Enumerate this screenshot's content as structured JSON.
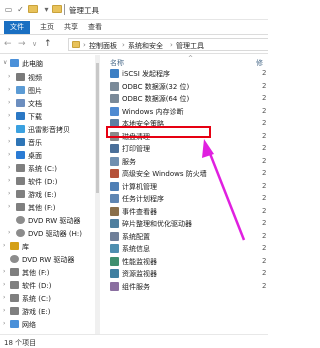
{
  "window": {
    "title": "管理工具"
  },
  "ribbon": {
    "tabs": [
      "文件",
      "主页",
      "共享",
      "查看"
    ]
  },
  "address": {
    "back": "←",
    "forward": "→",
    "recent": "∨",
    "up": "↑",
    "crumbs": [
      "控制面板",
      "系统和安全",
      "管理工具"
    ],
    "separator": "›"
  },
  "columns": {
    "name": "名称",
    "date_prefix": "修"
  },
  "nav": {
    "items": [
      {
        "label": "此电脑",
        "color": "#4a90d9"
      },
      {
        "label": "视频",
        "color": "#7a7a7a"
      },
      {
        "label": "图片",
        "color": "#5b9bd5"
      },
      {
        "label": "文档",
        "color": "#6c8ebf"
      },
      {
        "label": "下载",
        "color": "#2b78c5"
      },
      {
        "label": "迅雷影音拷贝",
        "color": "#3ba1e0"
      },
      {
        "label": "音乐",
        "color": "#2e75b6"
      },
      {
        "label": "桌面",
        "color": "#2a7bd4"
      },
      {
        "label": "系统 (C:)",
        "color": "#7f7f7f"
      },
      {
        "label": "软件 (D:)",
        "color": "#7f7f7f"
      },
      {
        "label": "游戏 (E:)",
        "color": "#7f7f7f"
      },
      {
        "label": "其他 (F:)",
        "color": "#7f7f7f"
      },
      {
        "label": "DVD RW 驱动器",
        "color": "#8c8c8c"
      },
      {
        "label": "DVD 驱动器 (H:)",
        "color": "#8c8c8c"
      },
      {
        "label": "库",
        "color": "#d4a017"
      },
      {
        "label": "DVD RW 驱动器",
        "color": "#8c8c8c"
      },
      {
        "label": "其他 (F:)",
        "color": "#7f7f7f"
      },
      {
        "label": "软件 (D:)",
        "color": "#7f7f7f"
      },
      {
        "label": "系统 (C:)",
        "color": "#7f7f7f"
      },
      {
        "label": "游戏 (E:)",
        "color": "#7f7f7f"
      },
      {
        "label": "网络",
        "color": "#4a90d9"
      }
    ]
  },
  "files": [
    {
      "name": "iSCSI 发起程序",
      "date": "2"
    },
    {
      "name": "ODBC 数据源(32 位)",
      "date": "2"
    },
    {
      "name": "ODBC 数据源(64 位)",
      "date": "2"
    },
    {
      "name": "Windows 内存诊断",
      "date": "2"
    },
    {
      "name": "本地安全策略",
      "date": "2"
    },
    {
      "name": "磁盘清理",
      "date": "2"
    },
    {
      "name": "打印管理",
      "date": "2"
    },
    {
      "name": "服务",
      "date": "2"
    },
    {
      "name": "高级安全 Windows 防火墙",
      "date": "2"
    },
    {
      "name": "计算机管理",
      "date": "2"
    },
    {
      "name": "任务计划程序",
      "date": "2"
    },
    {
      "name": "事件查看器",
      "date": "2"
    },
    {
      "name": "碎片整理和优化驱动器",
      "date": "2"
    },
    {
      "name": "系统配置",
      "date": "2"
    },
    {
      "name": "系统信息",
      "date": "2"
    },
    {
      "name": "性能监视器",
      "date": "2"
    },
    {
      "name": "资源监视器",
      "date": "2"
    },
    {
      "name": "组件服务",
      "date": "2"
    }
  ],
  "status": {
    "count": "18 个项目"
  },
  "colors": {
    "accent": "#1a6fc2",
    "highlight": "#e60012",
    "arrow": "#e020e0"
  }
}
